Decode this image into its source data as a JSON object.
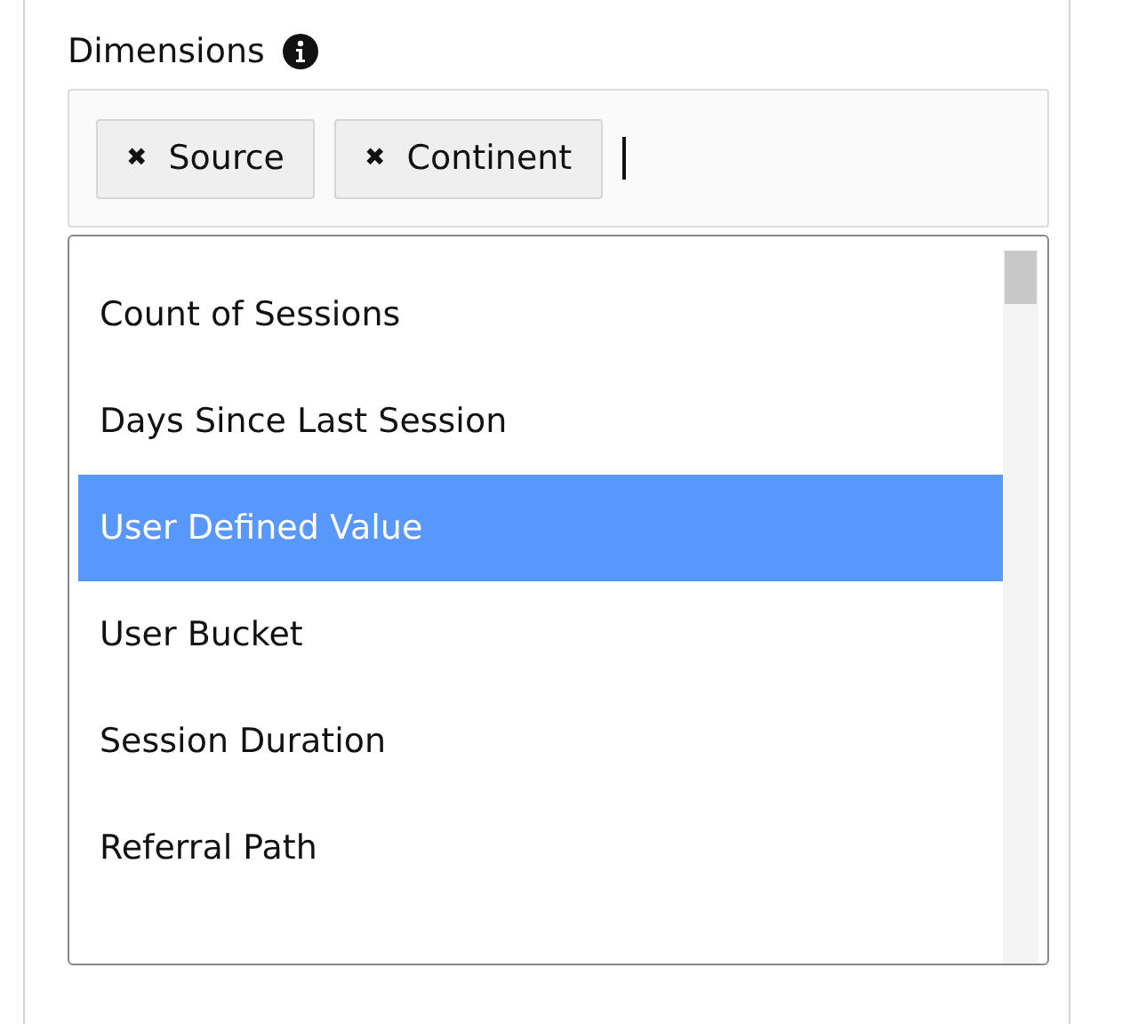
{
  "dimensions": {
    "label": "Dimensions",
    "chips": [
      {
        "remove": "✖",
        "label": "Source"
      },
      {
        "remove": "✖",
        "label": "Continent"
      }
    ],
    "options": [
      {
        "label": "Count of Sessions",
        "selected": false
      },
      {
        "label": "Days Since Last Session",
        "selected": false
      },
      {
        "label": "User Defined Value",
        "selected": true
      },
      {
        "label": "User Bucket",
        "selected": false
      },
      {
        "label": "Session Duration",
        "selected": false
      },
      {
        "label": "Referral Path",
        "selected": false
      }
    ]
  }
}
